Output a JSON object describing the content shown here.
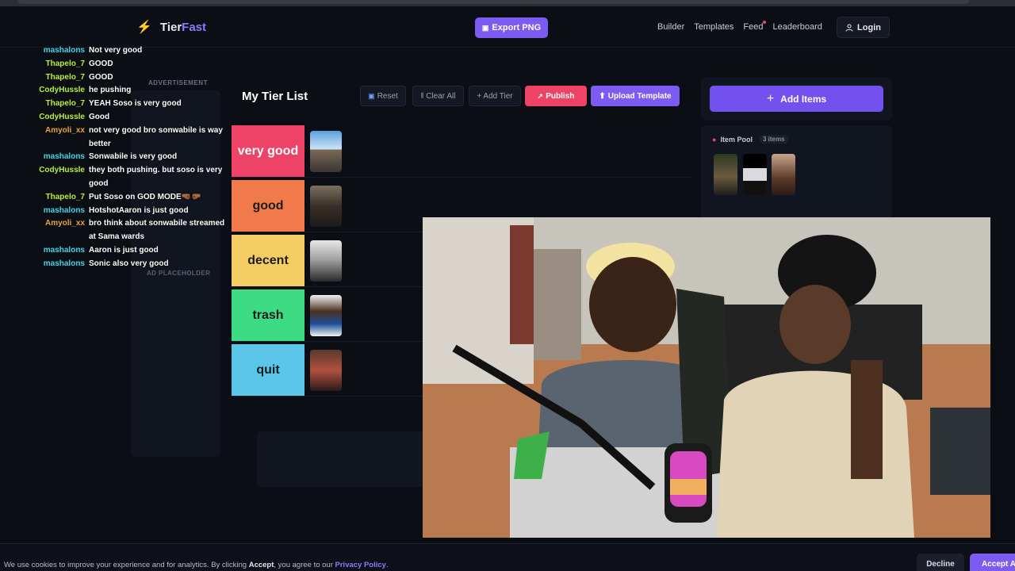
{
  "brand": {
    "part1": "Tier",
    "part2": "Fast",
    "icon": "lightning-bolt-icon",
    "accent": "#8b7bff"
  },
  "nav": {
    "export_label": "Export PNG",
    "links": [
      "Builder",
      "Templates",
      "Feed",
      "Leaderboard"
    ],
    "login_label": "Login"
  },
  "chat": {
    "messages": [
      {
        "user": "mashalons",
        "text": "Not very good",
        "color": "#45d3e8"
      },
      {
        "user": "Thapelo_7",
        "text": "GOOD",
        "color": "#b8f03a"
      },
      {
        "user": "Thapelo_7",
        "text": "GOOD",
        "color": "#b8f03a"
      },
      {
        "user": "CodyHussle",
        "text": "he pushing",
        "color": "#b8f03a"
      },
      {
        "user": "Thapelo_7",
        "text": "YEAH Soso is very good",
        "color": "#b8f03a"
      },
      {
        "user": "CodyHussle",
        "text": "Good",
        "color": "#b8f03a"
      },
      {
        "user": "Amyoli_xx",
        "text": "not very good bro sonwabile is way better",
        "color": "#e8a33a"
      },
      {
        "user": "mashalons",
        "text": "Sonwabile is very good",
        "color": "#45d3e8"
      },
      {
        "user": "CodyHussle",
        "text": "they both pushing. but soso is very good",
        "color": "#b8f03a"
      },
      {
        "user": "Thapelo_7",
        "text": "Put Soso on GOD MODE🤜🏾🤛🏾",
        "color": "#b8f03a"
      },
      {
        "user": "mashalons",
        "text": "HotshotAaron is just good",
        "color": "#45d3e8"
      },
      {
        "user": "Amyoli_xx",
        "text": "bro think about sonwabile streamed at Sama wards",
        "color": "#e8a33a"
      },
      {
        "user": "mashalons",
        "text": "Aaron is just good",
        "color": "#45d3e8"
      },
      {
        "user": "mashalons",
        "text": "Sonic also very good",
        "color": "#45d3e8"
      }
    ]
  },
  "ad": {
    "label": "ADVERTISEMENT",
    "placeholder": "AD PLACEHOLDER"
  },
  "tierlist": {
    "title": "My Tier List",
    "reset_label": "Reset",
    "clear_label": "Clear All",
    "add_tier_label": "+ Add Tier",
    "publish_label": "Publish",
    "upload_label": "Upload Template",
    "tiers": [
      {
        "label": "very good",
        "color": "#ee4266"
      },
      {
        "label": "good",
        "color": "#f07a4a"
      },
      {
        "label": "decent",
        "color": "#f5cd63"
      },
      {
        "label": "trash",
        "color": "#3ddc84"
      },
      {
        "label": "quit",
        "color": "#5bc6ea"
      }
    ]
  },
  "sidebar": {
    "add_items_label": "Add Items",
    "pool_title": "Item Pool",
    "pool_count": "3 items"
  },
  "cookie": {
    "text_prefix": "We use cookies to improve your experience and for analytics. By clicking ",
    "accept_word": "Accept",
    "text_middle": ", you agree to our ",
    "policy_link": "Privacy Policy",
    "text_end": ".",
    "decline_label": "Decline",
    "accept_label": "Accept A"
  }
}
